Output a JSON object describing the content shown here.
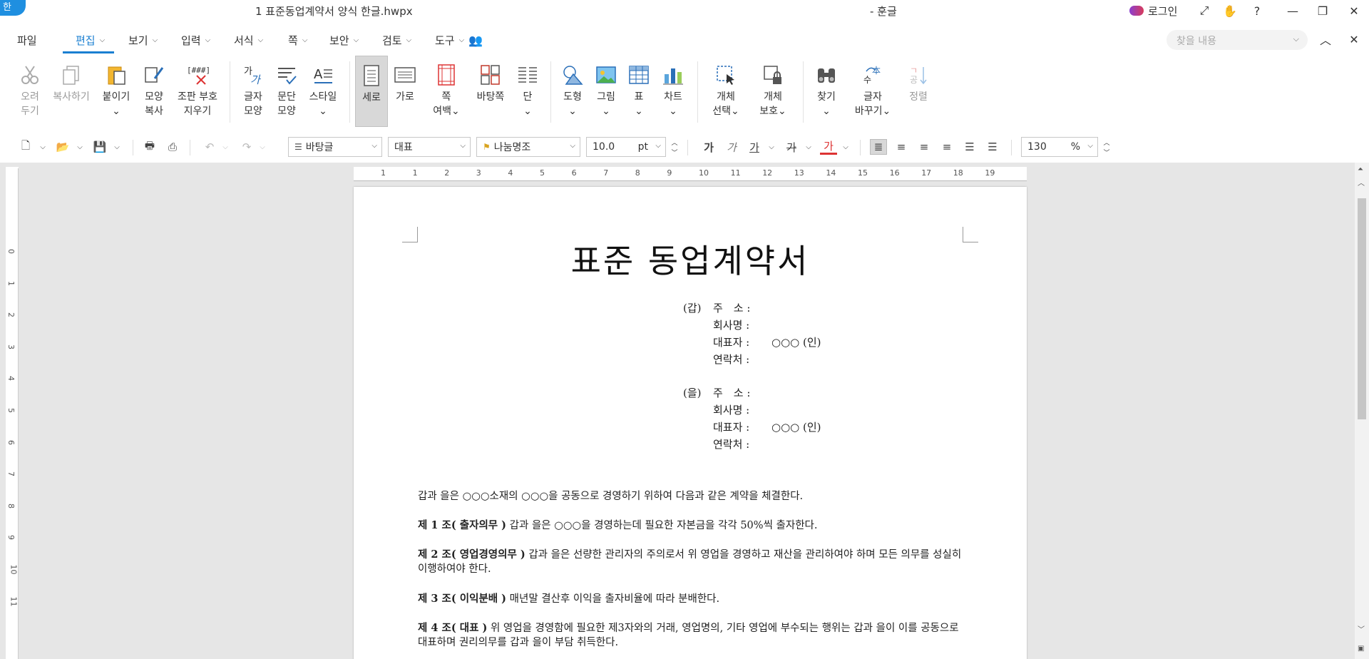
{
  "window": {
    "app_badge": "한",
    "doc_title": "1 표준동업계약서 양식 한글.hwpx",
    "app_name": "- 훈글",
    "login_label": "로그인"
  },
  "menu": {
    "items": [
      "파일",
      "편집",
      "보기",
      "입력",
      "서식",
      "쪽",
      "보안",
      "검토",
      "도구"
    ],
    "search_placeholder": "찾을 내용"
  },
  "ribbon": {
    "buttons": [
      {
        "label": "오려\n두기",
        "icon": "scissors-icon"
      },
      {
        "label": "복사하기",
        "icon": "copy-icon"
      },
      {
        "label": "붙이기\n⌄",
        "icon": "paste-icon"
      },
      {
        "label": "모양\n복사",
        "icon": "format-painter-icon"
      },
      {
        "label": "조판 부호\n지우기",
        "icon": "clear-code-icon"
      },
      {
        "label": "글자\n모양",
        "icon": "char-shape-icon"
      },
      {
        "label": "문단\n모양",
        "icon": "para-shape-icon"
      },
      {
        "label": "스타일\n⌄",
        "icon": "style-icon"
      },
      {
        "label": "세로",
        "icon": "portrait-icon"
      },
      {
        "label": "가로",
        "icon": "landscape-icon"
      },
      {
        "label": "쪽\n여백⌄",
        "icon": "page-margin-icon"
      },
      {
        "label": "바탕쪽",
        "icon": "master-page-icon"
      },
      {
        "label": "단\n⌄",
        "icon": "columns-icon"
      },
      {
        "label": "도형\n⌄",
        "icon": "shape-icon"
      },
      {
        "label": "그림\n⌄",
        "icon": "picture-icon"
      },
      {
        "label": "표\n⌄",
        "icon": "table-icon"
      },
      {
        "label": "차트\n⌄",
        "icon": "chart-icon"
      },
      {
        "label": "개체\n선택⌄",
        "icon": "object-select-icon"
      },
      {
        "label": "개체\n보호⌄",
        "icon": "object-protect-icon"
      },
      {
        "label": "찾기\n⌄",
        "icon": "binoculars-icon"
      },
      {
        "label": "글자\n바꾸기⌄",
        "icon": "replace-icon"
      },
      {
        "label": "정렬",
        "icon": "sort-icon"
      }
    ]
  },
  "format_bar": {
    "style": "바탕글",
    "lang": "대표",
    "font": "나눔명조",
    "size": "10.0",
    "size_unit": "pt",
    "zoom": "130",
    "zoom_unit": "%",
    "bold": "가",
    "italic": "가",
    "underline": "가",
    "strike": "가",
    "font_color": "가"
  },
  "ruler": {
    "h_ticks": [
      "1",
      "1",
      "2",
      "3",
      "4",
      "5",
      "6",
      "7",
      "8",
      "9",
      "10",
      "11",
      "12",
      "13",
      "14",
      "15",
      "16",
      "17",
      "18",
      "19"
    ],
    "v_ticks": [
      "0",
      "1",
      "2",
      "3",
      "4",
      "5",
      "6",
      "7",
      "8",
      "9",
      "10",
      "11"
    ]
  },
  "document": {
    "heading": "표준 동업계약서",
    "party_a": {
      "tag": "(갑)",
      "rows": [
        {
          "key": "주　소 :",
          "val": ""
        },
        {
          "key": "회사명 :",
          "val": ""
        },
        {
          "key": "대표자 :",
          "val": "○○○ (인)"
        },
        {
          "key": "연락처 :",
          "val": ""
        }
      ]
    },
    "party_b": {
      "tag": "(을)",
      "rows": [
        {
          "key": "주　소 :",
          "val": ""
        },
        {
          "key": "회사명 :",
          "val": ""
        },
        {
          "key": "대표자 :",
          "val": "○○○ (인)"
        },
        {
          "key": "연락처 :",
          "val": ""
        }
      ]
    },
    "intro": "갑과 을은 ○○○소재의 ○○○을 공동으로 경영하기 위하여 다음과 같은 계약을 체결한다.",
    "articles": [
      {
        "title": "제 1 조( 출자의무 )",
        "text": " 갑과 을은 ○○○을 경영하는데 필요한 자본금을 각각 50%씩 출자한다."
      },
      {
        "title": "제 2 조( 영업경영의무 )",
        "text": " 갑과 을은 선량한 관리자의 주의로서 위 영업을 경영하고 재산을 관리하여야 하며 모든 의무를 성실히 이행하여야 한다."
      },
      {
        "title": "제 3 조( 이익분배 )",
        "text": " 매년말 결산후 이익을 출자비율에 따라 분배한다."
      },
      {
        "title": "제 4 조( 대표 )",
        "text": " 위 영업을 경영함에 필요한 제3자와의 거래, 영업명의, 기타 영업에 부수되는 행위는 갑과 을이 이를 공동으로 대표하며 권리의무를 갑과 을이 부담 취득한다."
      }
    ]
  },
  "colors": {
    "accent": "#1a7fd1",
    "workspace": "#e6e6e6"
  }
}
